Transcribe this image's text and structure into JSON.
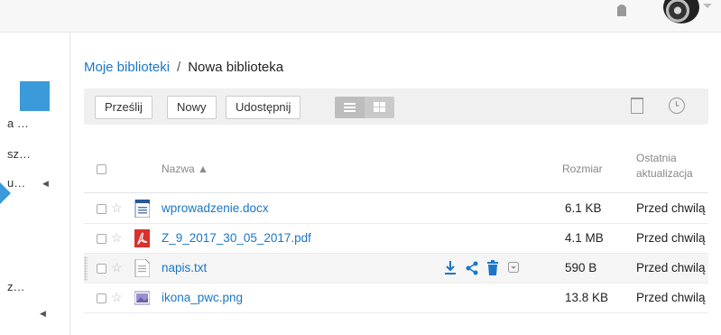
{
  "sidebar": {
    "items": [
      {
        "label": "a …"
      },
      {
        "label": "sz…"
      },
      {
        "label": "u…"
      },
      {
        "label": "z…"
      }
    ]
  },
  "breadcrumb": {
    "parent": "Moje biblioteki",
    "separator": "/",
    "current": "Nowa biblioteka"
  },
  "toolbar": {
    "upload_label": "Prześlij",
    "new_label": "Nowy",
    "share_label": "Udostępnij"
  },
  "table": {
    "columns": {
      "name": "Nazwa ▲",
      "size": "Rozmiar",
      "updated_line1": "Ostatnia",
      "updated_line2": "aktualizacja"
    },
    "rows": [
      {
        "name": "wprowadzenie.docx",
        "size": "6.1 KB",
        "updated": "Przed chwilą",
        "icon": "docx-file-icon"
      },
      {
        "name": "Z_9_2017_30_05_2017.pdf",
        "size": "4.1 MB",
        "updated": "Przed chwilą",
        "icon": "pdf-file-icon"
      },
      {
        "name": "napis.txt",
        "size": "590 B",
        "updated": "Przed chwilą",
        "icon": "txt-file-icon"
      },
      {
        "name": "ikona_pwc.png",
        "size": "13.8 KB",
        "updated": "Przed chwilą",
        "icon": "image-file-icon"
      }
    ]
  },
  "colors": {
    "accent": "#3b9ad9",
    "link": "#1b76c8",
    "pdf_red": "#d9312b"
  }
}
